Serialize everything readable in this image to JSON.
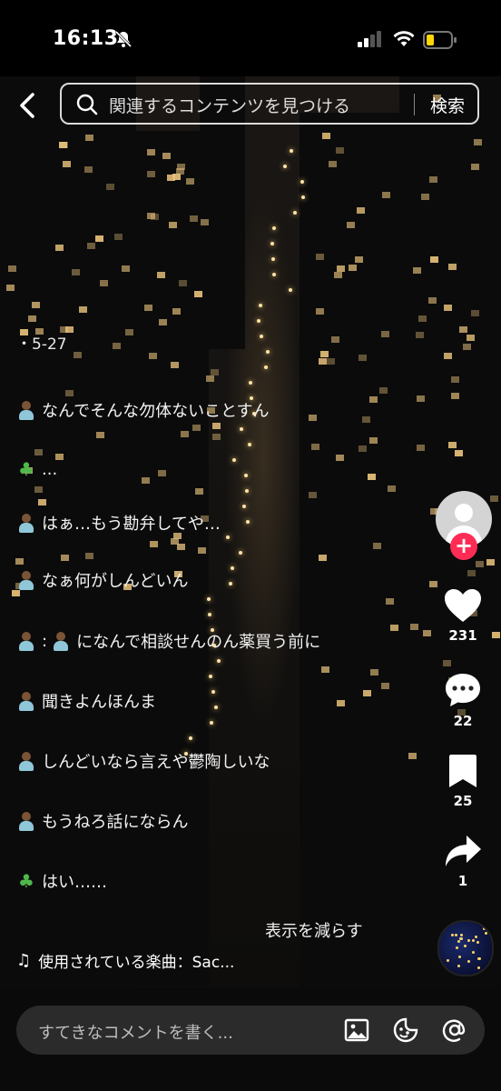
{
  "status_bar": {
    "time": "16:13",
    "bell_icon": "bell-slash-icon",
    "signal_icon": "cellular-signal-icon",
    "wifi_icon": "wifi-icon",
    "battery_icon": "battery-low-icon",
    "battery_color": "#ffd60a"
  },
  "top_bar": {
    "back_icon": "chevron-left-icon",
    "search_placeholder": "関連するコンテンツを見つける",
    "search_button": "検索"
  },
  "caption": {
    "date": "5-27",
    "lines": [
      {
        "emoji": "person",
        "text": "なんでそんな勿体ないことすん"
      },
      {
        "emoji": "clover",
        "text": "..."
      },
      {
        "emoji": "person",
        "text": "はぁ…もう勘弁してや…"
      },
      {
        "emoji": "person",
        "text": "なぁ何がしんどいん"
      },
      {
        "emoji": "person",
        "text": ":",
        "after_emoji": "person",
        "after_text": "になんで相談せんのん薬買う前に"
      },
      {
        "emoji": "person",
        "text": "聞きよんほんま"
      },
      {
        "emoji": "person",
        "text": "しんどいなら言えや鬱陶しいな"
      },
      {
        "emoji": "person",
        "text": "もうねろ話にならん"
      },
      {
        "emoji": "clover",
        "text": "はい……"
      }
    ],
    "show_less": "表示を減らす"
  },
  "music": {
    "label": "使用されている楽曲：Sac..."
  },
  "actions": {
    "like_count": "231",
    "comment_count": "22",
    "save_count": "25",
    "share_count": "1",
    "follow_color": "#fe2c55"
  },
  "bottom_bar": {
    "comment_placeholder": "すてきなコメントを書く...",
    "image_icon": "image-icon",
    "emoji_icon": "smiley-sticker-icon",
    "mention_icon": "at-icon"
  }
}
